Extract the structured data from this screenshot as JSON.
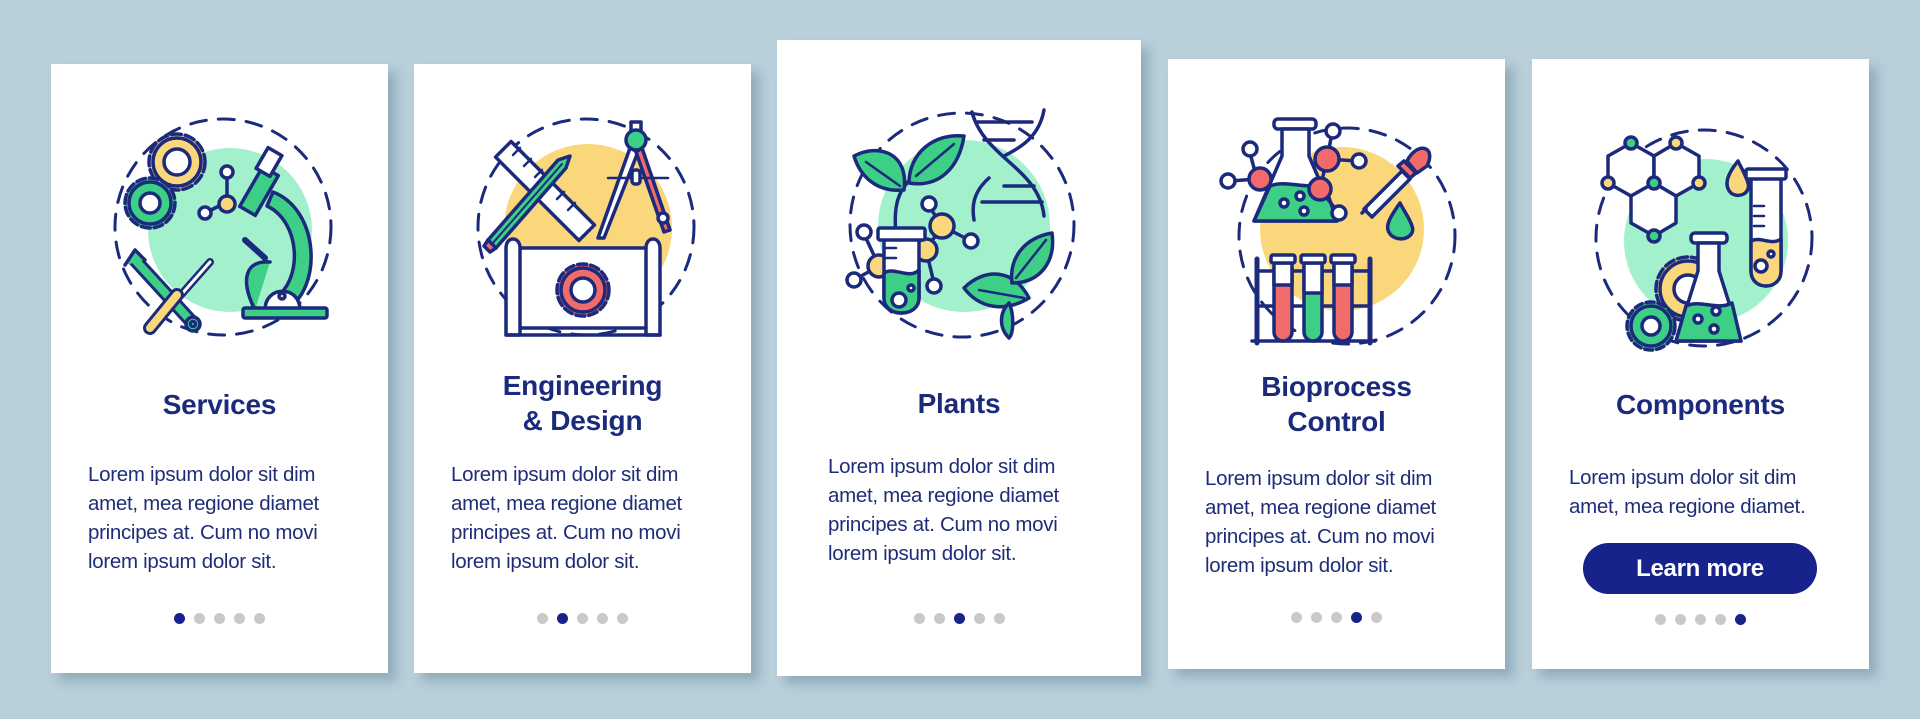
{
  "colors": {
    "background": "#b9cfda",
    "card": "#ffffff",
    "navy": "#1b2a7c",
    "button": "#17238a",
    "dot_inactive": "#c9c9c9",
    "green": "#3ecf86",
    "mint": "#a3f0cc",
    "yellow": "#fbd77c",
    "red": "#f26b6b"
  },
  "cards": [
    {
      "title": "Services",
      "body": "Lorem ipsum dolor sit dim\namet, mea regione diamet\nprincipes at. Cum no movi\nlorem ipsum dolor sit.",
      "icon": "microscope-tools-gears-icon",
      "active_step": 1
    },
    {
      "title": "Engineering\n& Design",
      "body": "Lorem ipsum dolor sit dim\namet, mea regione diamet\nprincipes at. Cum no movi\nlorem ipsum dolor sit.",
      "icon": "ruler-pencil-compass-blueprint-icon",
      "active_step": 2
    },
    {
      "title": "Plants",
      "body": "Lorem ipsum dolor sit dim\namet, mea regione diamet\nprincipes at. Cum no movi\nlorem ipsum dolor sit.",
      "icon": "plant-test-tube-dna-icon",
      "active_step": 3
    },
    {
      "title": "Bioprocess\nControl",
      "body": "Lorem ipsum dolor sit dim\namet, mea regione diamet\nprincipes at. Cum no movi\nlorem ipsum dolor sit.",
      "icon": "flask-pipette-test-tubes-icon",
      "active_step": 4
    },
    {
      "title": "Components",
      "body": "Lorem ipsum dolor sit dim\namet, mea regione diamet.",
      "icon": "molecule-flask-gears-icon",
      "active_step": 5,
      "button_label": "Learn more"
    }
  ],
  "total_steps": 5
}
